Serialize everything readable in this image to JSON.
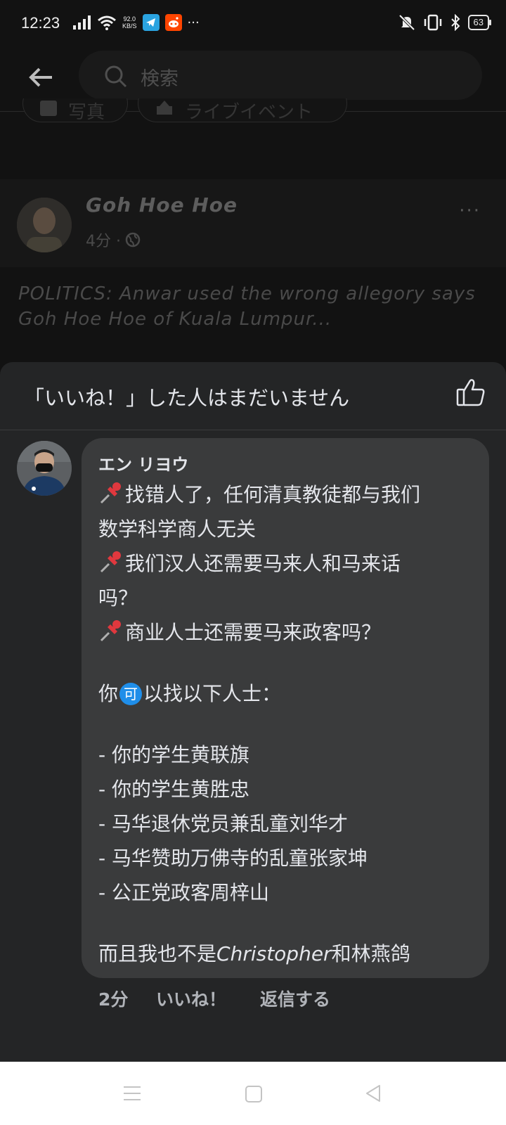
{
  "status_bar": {
    "time": "12:23",
    "net_speed_value": "92.0",
    "net_speed_unit": "KB/S",
    "more": "···",
    "battery": "63"
  },
  "search": {
    "placeholder": "検索"
  },
  "chips": [
    {
      "label": "写真",
      "icon": "photo-icon"
    },
    {
      "label": "ライブイベント",
      "icon": "live-event-icon"
    }
  ],
  "post": {
    "author": "Goh Hoe Hoe",
    "time": "4分 ·",
    "privacy_icon": "globe-icon",
    "more": "···",
    "text": "POLITICS: Anwar used the wrong allegory says Goh Hoe Hoe of Kuala Lumpur..."
  },
  "reactions_sheet": {
    "title": "「いいね！」した人はまだいません",
    "icon": "thumbs-up-icon"
  },
  "comment": {
    "author": "エン リヨウ",
    "lines": {
      "l1": "找错人了，任何清真教徒都与我们",
      "l2": "数学科学商人无关",
      "l3": "我们汉人还需要马来人和马来话",
      "l4": "吗？",
      "l5": "商业人士还需要马来政客吗？",
      "l6a": "你",
      "l6badge": "可",
      "l6b": "以找以下人士：",
      "l7": "- 你的学生黄联旗",
      "l8": "- 你的学生黄胜忠",
      "l9": "- 马华退休党员兼乱童刘华才",
      "l10": "- 马华赞助万佛寺的乱童张家坤",
      "l11": "- 公正党政客周梓山",
      "l12a": "而且我也不是",
      "l12b": "Christopher",
      "l12c": "和林燕鸽"
    },
    "time": "2分",
    "like_label": "いいね！",
    "reply_label": "返信する"
  },
  "colors": {
    "background": "#121212",
    "sheet": "#242526",
    "bubble": "#3a3b3c",
    "text": "#e4e6eb",
    "secondary_text": "#b0b3b8",
    "accent_badge": "#1f8ee9"
  }
}
